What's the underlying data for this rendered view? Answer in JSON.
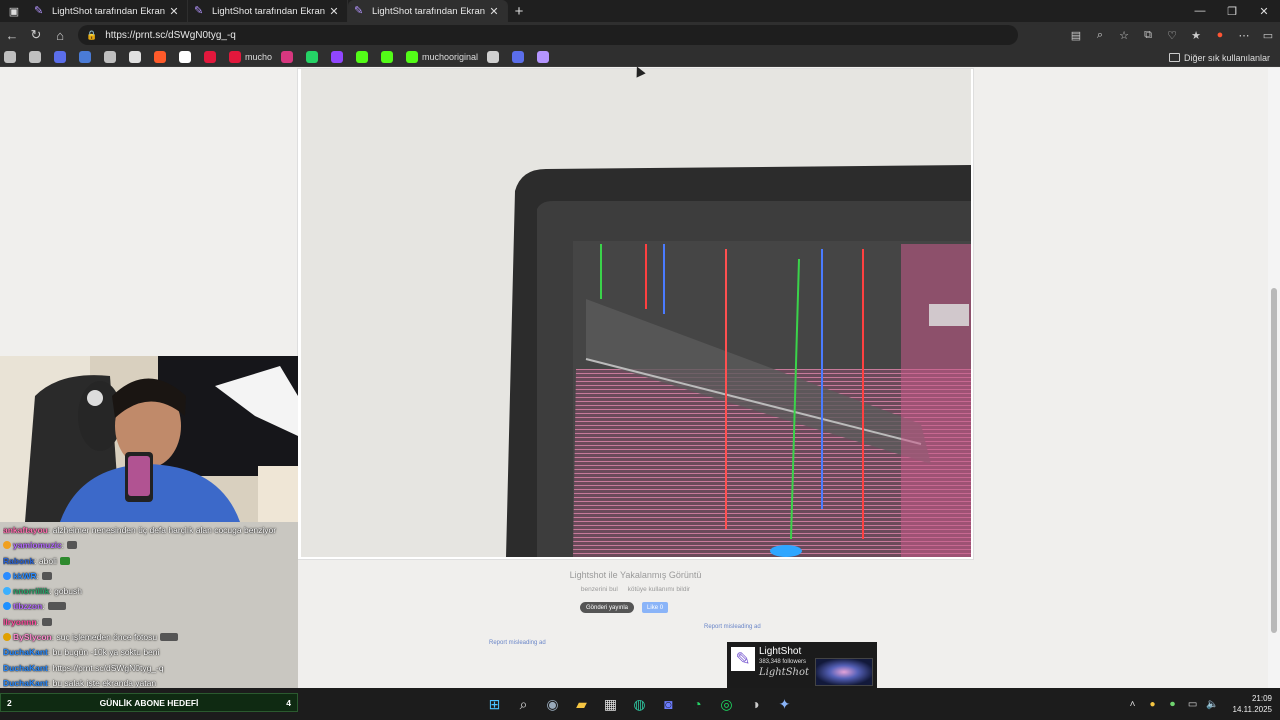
{
  "browser": {
    "tabs": [
      {
        "title": "LightShot tarafından Ekran Görün",
        "active": false
      },
      {
        "title": "LightShot tarafından Ekran Görün",
        "active": false
      },
      {
        "title": "LightShot tarafından Ekran Görün",
        "active": true
      }
    ],
    "url": "https://prnt.sc/dSWgN0tyg_-q",
    "bookmarks": [
      {
        "label": "",
        "color": "#c0c0c0"
      },
      {
        "label": "",
        "color": "#c0c0c0"
      },
      {
        "label": "",
        "color": "#5b6eea"
      },
      {
        "label": "",
        "color": "#4a7bd6"
      },
      {
        "label": "",
        "color": "#c0c0c0"
      },
      {
        "label": "",
        "color": "#e0e0e0"
      },
      {
        "label": "",
        "color": "#ff5a2a"
      },
      {
        "label": "",
        "color": "#ffffff"
      },
      {
        "label": "",
        "color": "#e2183c"
      },
      {
        "label": "mucho",
        "color": "#e2183c"
      },
      {
        "label": "",
        "color": "#d8377f"
      },
      {
        "label": "",
        "color": "#25d366"
      },
      {
        "label": "",
        "color": "#9146ff"
      },
      {
        "label": "",
        "color": "#53fc18"
      },
      {
        "label": "",
        "color": "#53fc18"
      },
      {
        "label": "muchooriginal",
        "color": "#53fc18"
      },
      {
        "label": "",
        "color": "#d0d0d0"
      },
      {
        "label": "",
        "color": "#5b6eea"
      },
      {
        "label": "",
        "color": "#b495ff"
      }
    ],
    "other_bookmarks": "Diğer sık kullanılanlar"
  },
  "page": {
    "caption": "Lightshot ile Yakalanmış Görüntü",
    "link_similar": "benzerini bul",
    "link_report_abuse": "kötüye kullanımı bildir",
    "share_button": "Gönderi yayınla",
    "like_button": "Like 0",
    "report_ad_left": "Report misleading ad",
    "report_ad_right": "Report misleading ad",
    "ad": {
      "name": "LightShot",
      "followers": "383,348 followers",
      "script": "LightShot"
    }
  },
  "chat": [
    {
      "user": "ankaftayou",
      "color": "#ff6fb0",
      "msg": ": alzheimer nenesinden üç defa harçlık alan cocuga benziyor",
      "emote": false,
      "badge": ""
    },
    {
      "user": "yamiomuzic",
      "color": "#b76cff",
      "msg": ":",
      "emote": true,
      "badge": "#f0a020"
    },
    {
      "user": "Rabonk",
      "color": "#2a64d6",
      "msg": ": aboli",
      "emote": true,
      "badge": ""
    },
    {
      "user": "kkWR",
      "color": "#2b8cff",
      "msg": ":",
      "emote": true,
      "badge": "#2b8cff"
    },
    {
      "user": "nnorrillik",
      "color": "#2aa36a",
      "msg": ": gobush",
      "emote": false,
      "badge": "#3bb0ff"
    },
    {
      "user": "tibzzon",
      "color": "#b76cff",
      "msg": ":",
      "emote": true,
      "badge": "#1e90ff"
    },
    {
      "user": "llryonnn",
      "color": "#ff4fa0",
      "msg": ":",
      "emote": true,
      "badge": ""
    },
    {
      "user": "BySlycon",
      "color": "#ff8cd0",
      "msg": ": suç işlemeden önce fotosu",
      "emote": true,
      "badge": "#e0a000"
    },
    {
      "user": "DuchaKant",
      "color": "#2b8cff",
      "msg": ": bu bugün -10k ya soktu beni",
      "emote": false,
      "badge": ""
    },
    {
      "user": "DuchaKant",
      "color": "#2b8cff",
      "msg": ": https://prnt.sc/dSWgN0tyg_-q",
      "emote": false,
      "badge": ""
    },
    {
      "user": "DuchaKant",
      "color": "#2b8cff",
      "msg": ": bu salak işte ekranda yatan",
      "emote": false,
      "badge": ""
    }
  ],
  "goal": {
    "left": "2",
    "label": "GÜNLİK ABONE HEDEFİ",
    "right": "4"
  },
  "taskbar": {
    "time": "21:09",
    "date": "14.11.2025"
  }
}
